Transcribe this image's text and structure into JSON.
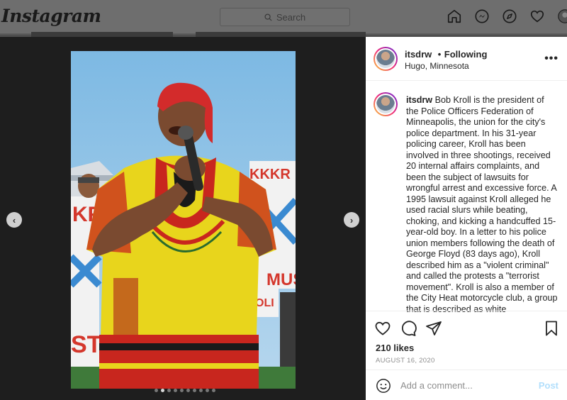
{
  "app": {
    "logo": "Instagram"
  },
  "search": {
    "placeholder": "Search"
  },
  "nav": {
    "icons": [
      "home-icon",
      "messenger-icon",
      "explore-icon",
      "heart-icon",
      "profile-icon"
    ]
  },
  "post": {
    "username": "itsdrw",
    "follow_separator": "•",
    "follow_status": "Following",
    "location": "Hugo, Minnesota",
    "more": "•••",
    "caption_user": "itsdrw",
    "caption_text": "Bob Kroll is the president of the Police Officers Federation of Minneapolis, the union for the city's police department. In his 31-year policing career, Kroll has been involved in three shootings, received 20 internal affairs complaints, and been the subject of lawsuits for wrongful arrest and excessive force. A 1995 lawsuit against Kroll alleged he used racial slurs while beating, choking, and kicking a handcuffed 15-year-old boy. In a letter to his police union members following the death of George Floyd (83 days ago), Kroll described him as a \"violent criminal\" and called the protests a \"terrorist movement\". Kroll is also a member of the City Heat motorcycle club, a group that is described as white",
    "likes": "210 likes",
    "date": "AUGUST 16, 2020",
    "comment_placeholder": "Add a comment...",
    "post_button": "Post",
    "carousel": {
      "total": 10,
      "active": 2
    }
  },
  "photo_signs": [
    "KKKR",
    "KR",
    "MUS",
    "ST",
    "OLI"
  ],
  "colors": {
    "accent": "#0095f6",
    "post_disabled": "#b2dffc",
    "meta": "#8e8e8e"
  }
}
